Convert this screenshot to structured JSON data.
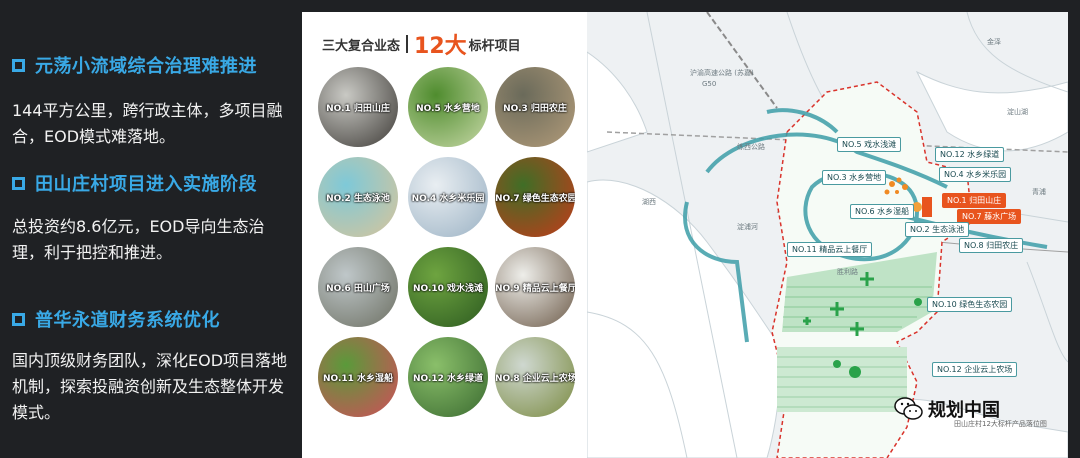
{
  "sections": [
    {
      "heading": "元荡小流域综合治理难推进",
      "text": "144平方公里，跨行政主体，多项目融合，EOD模式难落地。"
    },
    {
      "heading": "田山庄村项目进入实施阶段",
      "text": "总投资约8.6亿元，EOD导向生态治理，利于把控和推进。"
    },
    {
      "heading": "普华永道财务系统优化",
      "text": "国内顶级财务团队，深化EOD项目落地机制，探索投融资创新及生态整体开发模式。"
    }
  ],
  "panel": {
    "title_a": "三大复合业态",
    "title_b": "12大",
    "title_c": "标杆项目"
  },
  "projects": [
    {
      "label": "NO.1 归田山庄",
      "colors": [
        "#c9c9c4",
        "#3d3a36"
      ]
    },
    {
      "label": "NO.5 水乡营地",
      "colors": [
        "#4f8c2e",
        "#c8d9a8"
      ]
    },
    {
      "label": "NO.3 归田农庄",
      "colors": [
        "#6a6a5a",
        "#b39c7a"
      ]
    },
    {
      "label": "NO.2 生态泳池",
      "colors": [
        "#7ec9d8",
        "#d8c49a"
      ]
    },
    {
      "label": "NO.4 水乡米乐园",
      "colors": [
        "#e9eef2",
        "#9bb2c4"
      ]
    },
    {
      "label": "NO.7 绿色生态农园",
      "colors": [
        "#3f6e26",
        "#c53a1a"
      ]
    },
    {
      "label": "NO.6 田山广场",
      "colors": [
        "#bfc7c9",
        "#6c6f62"
      ]
    },
    {
      "label": "NO.10 戏水浅滩",
      "colors": [
        "#6ea440",
        "#2c5a20"
      ]
    },
    {
      "label": "NO.9 精品云上餐厅",
      "colors": [
        "#eeeeea",
        "#6c5a48"
      ]
    },
    {
      "label": "NO.11 水乡湿船",
      "colors": [
        "#5a9a3a",
        "#d24d5a"
      ]
    },
    {
      "label": "NO.12 水乡绿道",
      "colors": [
        "#8abf6a",
        "#3a6a30"
      ]
    },
    {
      "label": "NO.8 企业云上农场",
      "colors": [
        "#cfd8d0",
        "#7a8a40"
      ]
    }
  ],
  "map": {
    "labels": [
      {
        "text": "沪渝高速公路 (苏嘉)"
      },
      {
        "text": "G50"
      },
      {
        "text": "湖西"
      },
      {
        "text": "淀山湖"
      },
      {
        "text": "青浦"
      },
      {
        "text": "胜利路"
      },
      {
        "text": "淀浦河"
      },
      {
        "text": "练西公路"
      },
      {
        "text": "金泽"
      }
    ],
    "tags": [
      {
        "text": "NO.5 戏水浅滩",
        "style": "normal"
      },
      {
        "text": "NO.12 水乡绿道",
        "style": "normal"
      },
      {
        "text": "NO.4 水乡米乐园",
        "style": "normal"
      },
      {
        "text": "NO.3 水乡营地",
        "style": "normal"
      },
      {
        "text": "NO.1 归田山庄",
        "style": "orange"
      },
      {
        "text": "NO.6 水乡湿船",
        "style": "normal"
      },
      {
        "text": "NO.7 藤水广场",
        "style": "orange"
      },
      {
        "text": "NO.2 生态泳池",
        "style": "normal"
      },
      {
        "text": "NO.11 精品云上餐厅",
        "style": "normal"
      },
      {
        "text": "NO.8 归田农庄",
        "style": "normal"
      },
      {
        "text": "NO.10 绿色生态农园",
        "style": "normal"
      },
      {
        "text": "NO.12 企业云上农场",
        "style": "normal"
      }
    ]
  },
  "watermark": {
    "name": "规划中国",
    "caption": "田山庄村12大标杆产品落位图"
  }
}
